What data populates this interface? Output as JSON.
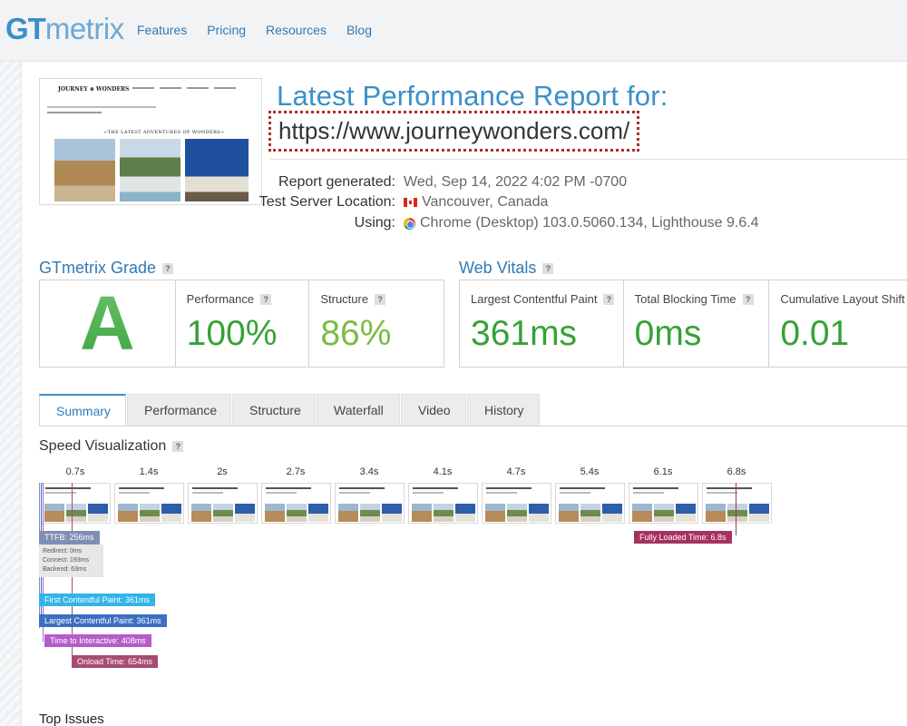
{
  "nav": {
    "logo_gt": "GT",
    "logo_metrix": "metrix",
    "links": [
      "Features",
      "Pricing",
      "Resources",
      "Blog"
    ]
  },
  "thumbnail": {
    "site_name": "JOURNEY ⊕ WONDERS",
    "heading": "~THE LATEST ADVENTURES OF WONDERS~"
  },
  "report": {
    "title": "Latest Performance Report for:",
    "url": "https://www.journeywonders.com/",
    "generated_label": "Report generated:",
    "generated_value": "Wed, Sep 14, 2022 4:02 PM -0700",
    "server_label": "Test Server Location:",
    "server_value": "Vancouver, Canada",
    "using_label": "Using:",
    "using_value": "Chrome (Desktop) 103.0.5060.134, Lighthouse 9.6.4"
  },
  "grade": {
    "title": "GTmetrix Grade",
    "letter": "A",
    "performance_label": "Performance",
    "performance_value": "100%",
    "structure_label": "Structure",
    "structure_value": "86%"
  },
  "vitals": {
    "title": "Web Vitals",
    "lcp_label": "Largest Contentful Paint",
    "lcp_value": "361ms",
    "tbt_label": "Total Blocking Time",
    "tbt_value": "0ms",
    "cls_label": "Cumulative Layout Shift",
    "cls_value": "0.01"
  },
  "tabs": [
    "Summary",
    "Performance",
    "Structure",
    "Waterfall",
    "Video",
    "History"
  ],
  "active_tab": "Summary",
  "speed_viz": {
    "title": "Speed Visualization",
    "frame_times": [
      "0.7s",
      "1.4s",
      "2s",
      "2.7s",
      "3.4s",
      "4.1s",
      "4.7s",
      "5.4s",
      "6.1s",
      "6.8s"
    ],
    "ttfb": "TTFB: 256ms",
    "ttfb_details": [
      "Redirect: 0ms",
      "Connect: 193ms",
      "Backend: 63ms"
    ],
    "fully_loaded": "Fully Loaded Time: 6.8s",
    "fcp": "First Contentful Paint: 361ms",
    "lcp": "Largest Contentful Paint: 361ms",
    "tti": "Time to Interactive: 408ms",
    "onload": "Onload Time: 654ms"
  },
  "top_issues_title": "Top Issues",
  "colors": {
    "brand_blue": "#3a8fc9",
    "grade_green": "#3ea43f",
    "perf_green": "#35a235",
    "structure_green": "#7cbb42",
    "ttfb": "#7d8fb5",
    "fcp": "#33b4e8",
    "lcp": "#3c6fc2",
    "tti": "#b45cc9",
    "onload": "#a84b73",
    "fully_loaded": "#a6325f"
  }
}
